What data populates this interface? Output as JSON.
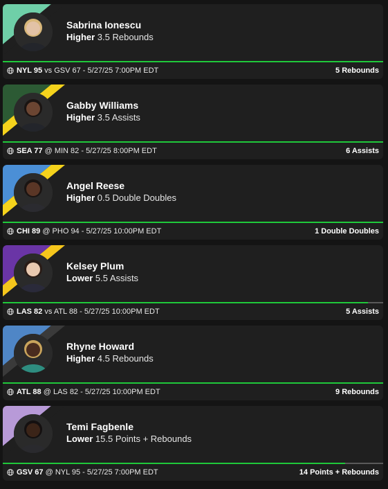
{
  "picks": [
    {
      "name": "Sabrina Ionescu",
      "direction": "Higher",
      "line": "3.5 Rebounds",
      "team": "NYL",
      "team_score": "95",
      "sep": "vs",
      "opponent": "GSV",
      "opponent_score": "67",
      "datetime": "5/27/25 7:00PM EDT",
      "result": "5 Rebounds",
      "progress": 1.0,
      "colors": {
        "primary": "#6fcfa8",
        "secondary": "#1f1f1f"
      }
    },
    {
      "name": "Gabby Williams",
      "direction": "Higher",
      "line": "3.5 Assists",
      "team": "SEA",
      "team_score": "77",
      "sep": "@",
      "opponent": "MIN",
      "opponent_score": "82",
      "datetime": "5/27/25 8:00PM EDT",
      "result": "6 Assists",
      "progress": 1.0,
      "colors": {
        "primary": "#2c5a34",
        "secondary": "#f5d31c"
      }
    },
    {
      "name": "Angel Reese",
      "direction": "Higher",
      "line": "0.5 Double Doubles",
      "team": "CHI",
      "team_score": "89",
      "sep": "@",
      "opponent": "PHO",
      "opponent_score": "94",
      "datetime": "5/27/25 10:00PM EDT",
      "result": "1 Double Doubles",
      "progress": 1.0,
      "colors": {
        "primary": "#4b8fd6",
        "secondary": "#f5d31c"
      }
    },
    {
      "name": "Kelsey Plum",
      "direction": "Lower",
      "line": "5.5 Assists",
      "team": "LAS",
      "team_score": "82",
      "sep": "vs",
      "opponent": "ATL",
      "opponent_score": "88",
      "datetime": "5/27/25 10:00PM EDT",
      "result": "5 Assists",
      "progress": 0.96,
      "colors": {
        "primary": "#6a35a6",
        "secondary": "#f5c61c"
      }
    },
    {
      "name": "Rhyne Howard",
      "direction": "Higher",
      "line": "4.5 Rebounds",
      "team": "ATL",
      "team_score": "88",
      "sep": "@",
      "opponent": "LAS",
      "opponent_score": "82",
      "datetime": "5/27/25 10:00PM EDT",
      "result": "9 Rebounds",
      "progress": 1.0,
      "colors": {
        "primary": "#4f86c6",
        "secondary": "#3a3a3a"
      }
    },
    {
      "name": "Temi Fagbenle",
      "direction": "Lower",
      "line": "15.5 Points + Rebounds",
      "team": "GSV",
      "team_score": "67",
      "sep": "@",
      "opponent": "NYL",
      "opponent_score": "95",
      "datetime": "5/27/25 7:00PM EDT",
      "result": "14 Points + Rebounds",
      "progress": 0.9,
      "colors": {
        "primary": "#b89ad8",
        "secondary": "#1f1f1f"
      }
    }
  ],
  "icons": {
    "matchup": "globe-icon",
    "avatar": "player-headshot"
  }
}
